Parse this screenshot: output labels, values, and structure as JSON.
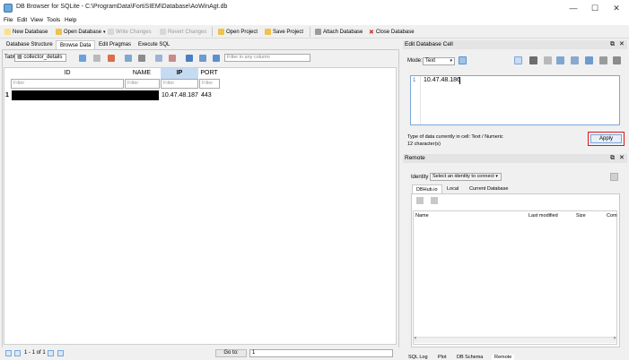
{
  "window": {
    "title": "DB Browser for SQLite - C:\\ProgramData\\FortiSIEM\\Database\\AoWinAgt.db",
    "minimize": "—",
    "maximize": "☐",
    "close": "✕"
  },
  "menu": [
    "File",
    "Edit",
    "View",
    "Tools",
    "Help"
  ],
  "toolbar": {
    "new_database": "New Database",
    "open_database": "Open Database",
    "write_changes": "Write Changes",
    "revert_changes": "Revert Changes",
    "open_project": "Open Project",
    "save_project": "Save Project",
    "attach_database": "Attach Database",
    "close_database": "Close Database"
  },
  "tabs": [
    "Database Structure",
    "Browse Data",
    "Edit Pragmas",
    "Execute SQL"
  ],
  "browse": {
    "table_label": "Table:",
    "table_value": "collector_details",
    "filter_all_placeholder": "Filter in any column",
    "columns": [
      "ID",
      "NAME",
      "IP",
      "PORT"
    ],
    "filter_placeholder": "Filter",
    "rows": [
      {
        "rownum": "1",
        "id": "",
        "name": "",
        "ip": "10.47.48.187",
        "port": "443"
      }
    ],
    "record_status": "1 - 1 of 1",
    "goto_label": "Go to:",
    "goto_value": "1"
  },
  "edit_cell": {
    "title": "Edit Database Cell",
    "mode_label": "Mode:",
    "mode_value": "Text",
    "line_number": "1",
    "value": "10.47.48.186",
    "type_info": "Type of data currently in cell: Text / Numeric",
    "size_info": "12 character(s)",
    "apply": "Apply"
  },
  "remote": {
    "title": "Remote",
    "identity_label": "Identity",
    "identity_value": "Select an identity to connect",
    "tabs": [
      "DBHub.io",
      "Local",
      "Current Database"
    ],
    "columns": [
      "Name",
      "Last modified",
      "Size",
      "Commit"
    ]
  },
  "bottom_tabs": [
    "SQL Log",
    "Plot",
    "DB Schema",
    "Remote"
  ],
  "colors": {
    "selected_header": "#c5dbf2",
    "apply_highlight": "#e0151b",
    "redaction": "#000000"
  }
}
